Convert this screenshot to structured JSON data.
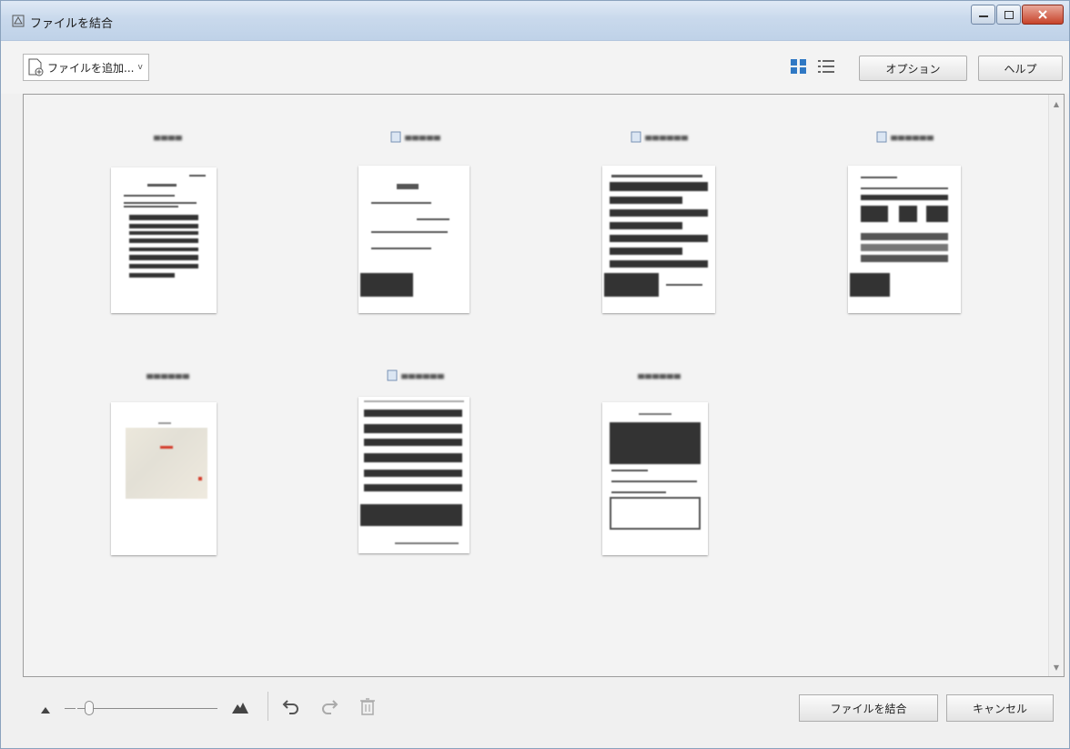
{
  "window": {
    "title": "ファイルを結合",
    "controls": [
      "minimize",
      "maximize",
      "close"
    ]
  },
  "toolbar": {
    "add_file_label": "ファイルを追加...",
    "add_file_caret": "v",
    "view_modes": [
      "thumbnail-grid-icon",
      "list-view-icon"
    ],
    "active_view": "thumbnail-grid-icon",
    "options_label": "オプション",
    "help_label": "ヘルプ"
  },
  "files": [
    {
      "name": "▄▄▄▄"
    },
    {
      "name": "▄▄▄▄▄"
    },
    {
      "name": "▄▄▄▄▄▄"
    },
    {
      "name": "▄▄▄▄▄▄"
    },
    {
      "name": "▄▄▄▄▄▄"
    },
    {
      "name": "▄▄▄▄▄▄"
    },
    {
      "name": "▄▄▄▄▄▄"
    }
  ],
  "statusbar": {
    "zoom_level": 0.1,
    "merge_label": "ファイルを結合",
    "cancel_label": "キャンセル"
  },
  "colors": {
    "accent": "#2f78c4",
    "titlebar": "#c9d9ec",
    "close_button": "#c7432a"
  }
}
